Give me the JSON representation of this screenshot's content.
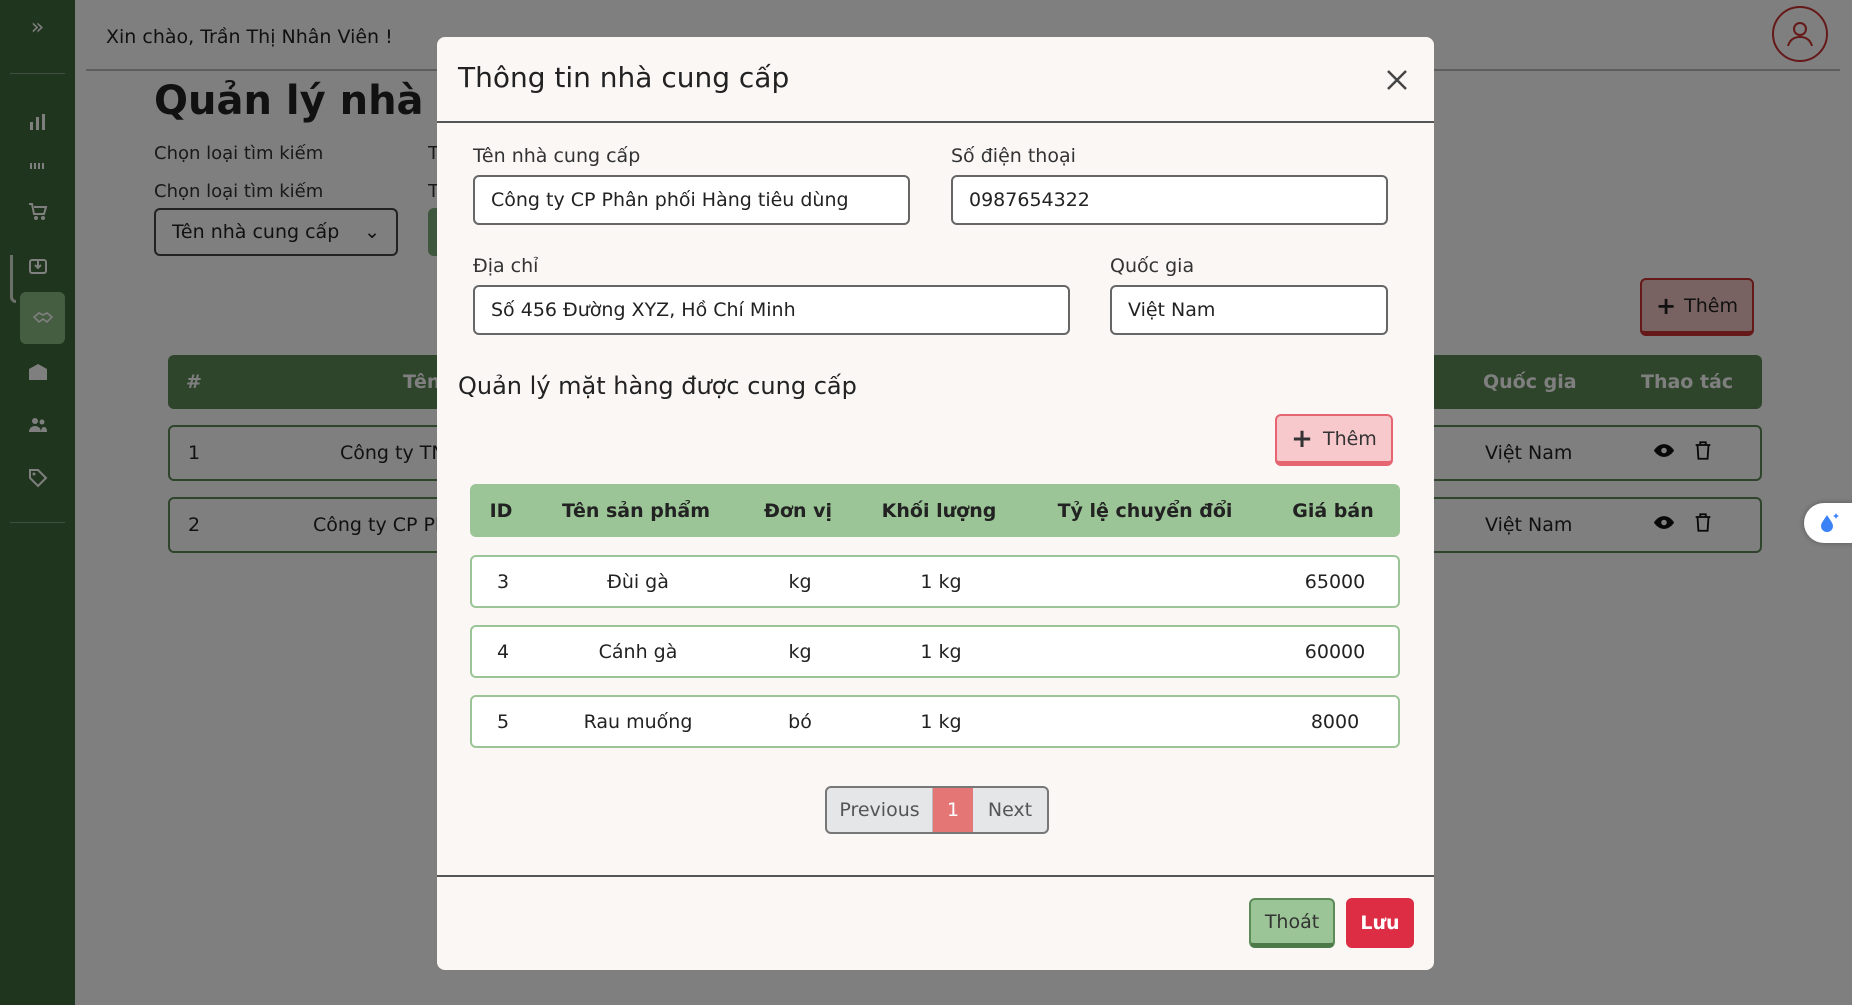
{
  "topbar": {
    "greeting": "Xin chào, Trần Thị Nhân Viên !"
  },
  "page": {
    "title": "Quản lý nhà cu",
    "filter_label_1": "Chọn loại tìm kiếm",
    "filter_label_2": "Chọn loại tìm kiếm",
    "filter_letter_1": "T",
    "filter_letter_2": "T",
    "filter_select": "Tên nhà cung cấp",
    "add_label": "Thêm"
  },
  "bg_table": {
    "headers": {
      "index": "#",
      "name": "Tên",
      "country": "Quốc gia",
      "actions": "Thao tác"
    },
    "rows": [
      {
        "index": "1",
        "name": "Công ty TN",
        "country": "Việt Nam"
      },
      {
        "index": "2",
        "name": "Công ty CP Pl",
        "country": "Việt Nam"
      }
    ]
  },
  "modal": {
    "title": "Thông tin nhà cung cấp",
    "fields": {
      "name_label": "Tên nhà cung cấp",
      "name_value": "Công ty CP Phân phối Hàng tiêu dùng",
      "phone_label": "Số điện thoại",
      "phone_value": "0987654322",
      "address_label": "Địa chỉ",
      "address_value": "Số 456 Đường XYZ, Hồ Chí Minh",
      "country_label": "Quốc gia",
      "country_value": "Việt Nam"
    },
    "section_title": "Quản lý mặt hàng được cung cấp",
    "add_button": "Thêm",
    "product_headers": {
      "id": "ID",
      "name": "Tên sản phẩm",
      "unit": "Đơn vị",
      "weight": "Khối lượng",
      "ratio": "Tỷ lệ chuyển đổi",
      "price": "Giá bán"
    },
    "products": [
      {
        "id": "3",
        "name": "Đùi gà",
        "unit": "kg",
        "weight": "1 kg",
        "ratio": "",
        "price": "65000"
      },
      {
        "id": "4",
        "name": "Cánh gà",
        "unit": "kg",
        "weight": "1 kg",
        "ratio": "",
        "price": "60000"
      },
      {
        "id": "5",
        "name": "Rau muống",
        "unit": "bó",
        "weight": "1 kg",
        "ratio": "",
        "price": "8000"
      }
    ],
    "pagination": {
      "previous": "Previous",
      "current": "1",
      "next": "Next"
    },
    "footer": {
      "exit": "Thoát",
      "save": "Lưu"
    }
  },
  "colors": {
    "sidebar": "#3e6a3a",
    "table_header": "#9cc597",
    "accent_red": "#dc2d45",
    "pagination_active": "#e47776"
  }
}
